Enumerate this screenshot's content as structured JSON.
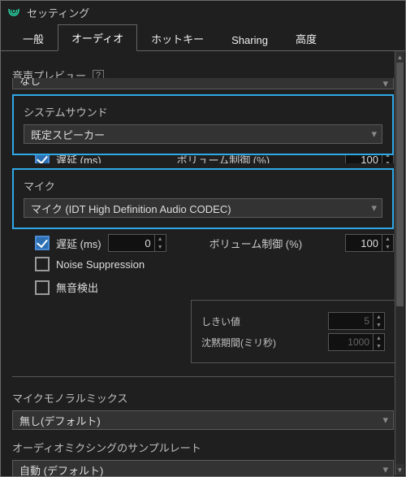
{
  "window": {
    "title": "セッティング"
  },
  "tabs": {
    "general": {
      "label": "一般"
    },
    "audio": {
      "label": "オーディオ"
    },
    "hotkey": {
      "label": "ホットキー"
    },
    "sharing": {
      "label": "Sharing"
    },
    "advanced": {
      "label": "高度"
    }
  },
  "audio_page": {
    "preview_label": "音声プレビュー",
    "preview_value": "なし",
    "system_sound_title": "システムサウンド",
    "system_sound_value": "既定スピーカー",
    "mic_title": "マイク",
    "mic_value": "マイク (IDT High Definition Audio CODEC)",
    "latency_label": "遅延 (ms)",
    "latency_value": "0",
    "volume_limit_label": "ボリューム制御 (%)",
    "volume_limit_value": "100",
    "noise_suppression_label": "Noise Suppression",
    "silence_detect_label": "無音検出",
    "threshold_label": "しきい値",
    "threshold_value": "5",
    "silence_duration_label": "沈黙期間(ミリ秒)",
    "silence_duration_value": "1000",
    "mono_mix_label": "マイクモノラルミックス",
    "mono_mix_value": "無し(デフォルト)",
    "audio_mix_rate_label": "オーディオミクシングのサンプルレート",
    "audio_mix_rate_value": "自動 (デフォルト)"
  },
  "glyphs": {
    "arrow_down": "▾",
    "arrow_up_small": "▲",
    "arrow_down_small": "▼",
    "help": "?"
  }
}
